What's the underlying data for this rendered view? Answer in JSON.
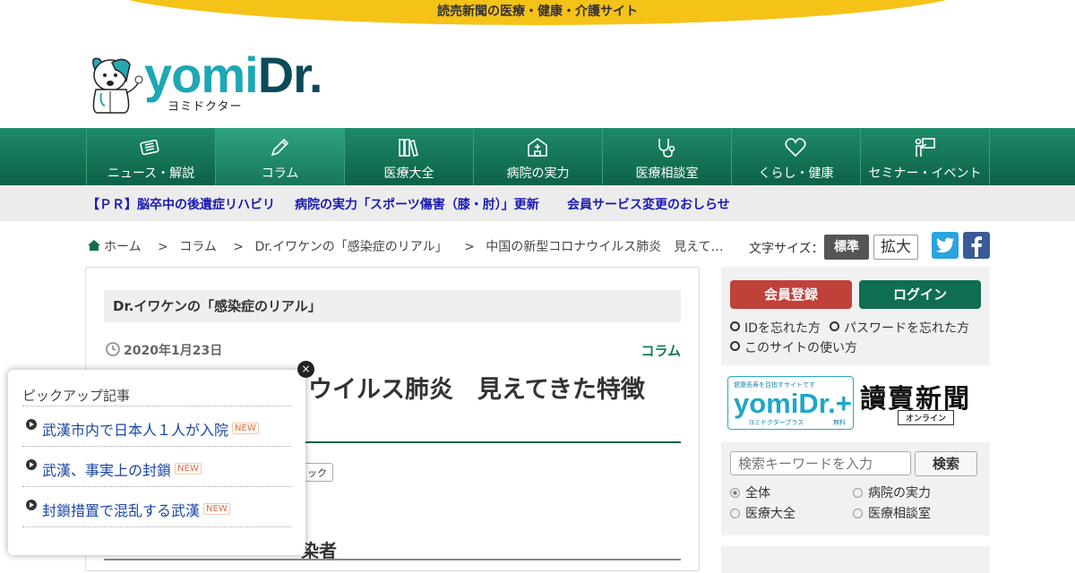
{
  "tagline": "読売新聞の医療・健康・介護サイト",
  "logo": {
    "word_a": "yomi",
    "word_b": "Dr.",
    "kana": "ヨミドクター"
  },
  "nav": [
    {
      "label": "ニュース・解説",
      "icon": "news-icon"
    },
    {
      "label": "コラム",
      "icon": "pen-icon",
      "active": true
    },
    {
      "label": "医療大全",
      "icon": "books-icon"
    },
    {
      "label": "病院の実力",
      "icon": "hospital-icon"
    },
    {
      "label": "医療相談室",
      "icon": "stethoscope-icon"
    },
    {
      "label": "くらし・健康",
      "icon": "heart-icon"
    },
    {
      "label": "セミナー・イベント",
      "icon": "presenter-icon"
    }
  ],
  "promo": [
    "【ＰＲ】脳卒中の後遺症リハビリ",
    "病院の実力「スポーツ傷害（膝・肘）」更新",
    "会員サービス変更のおしらせ"
  ],
  "breadcrumb": {
    "home": "ホーム",
    "sep": ">",
    "items": [
      "コラム",
      "Dr.イワケンの「感染症のリアル」",
      "中国の新型コロナウイルス肺炎　見えて…"
    ]
  },
  "font_size": {
    "label": "文字サイズ：",
    "standard": "標準",
    "large": "拡大"
  },
  "article": {
    "series": "Dr.イワケンの「感染症のリアル」",
    "date": "2020年1月23日",
    "category": "コラム",
    "title_visible": "ウイルス肺炎　見えてきた特徴",
    "tag_visible": "ック",
    "subhead_visible": "染者"
  },
  "sidebar": {
    "register": "会員登録",
    "login": "ログイン",
    "forgot_id": "IDを忘れた方",
    "forgot_pw": "パスワードを忘れた方",
    "howto": "このサイトの使い方",
    "plus_top": "健康長寿を目指すサイトです",
    "plus_main": "yomiDr.+",
    "plus_sub": "ヨミドクタープラス",
    "plus_free": "無料",
    "yomiuri": "讀賣新聞",
    "yomiuri_online": "オンライン",
    "search_placeholder": "検索キーワードを入力",
    "search_btn": "検索",
    "radios": [
      "全体",
      "病院の実力",
      "医療大全",
      "医療相談室"
    ]
  },
  "popup": {
    "heading": "ピックアップ記事",
    "close": "×",
    "items": [
      "武漢市内で日本人１人が入院",
      "武漢、事実上の封鎖",
      "封鎖措置で混乱する武漢"
    ],
    "new_badge": "NEW"
  },
  "colors": {
    "nav_green": "#0f6e52",
    "tagline_yellow": "#f5c218",
    "register_red": "#c0413a",
    "link_blue": "#1a1ab0"
  }
}
